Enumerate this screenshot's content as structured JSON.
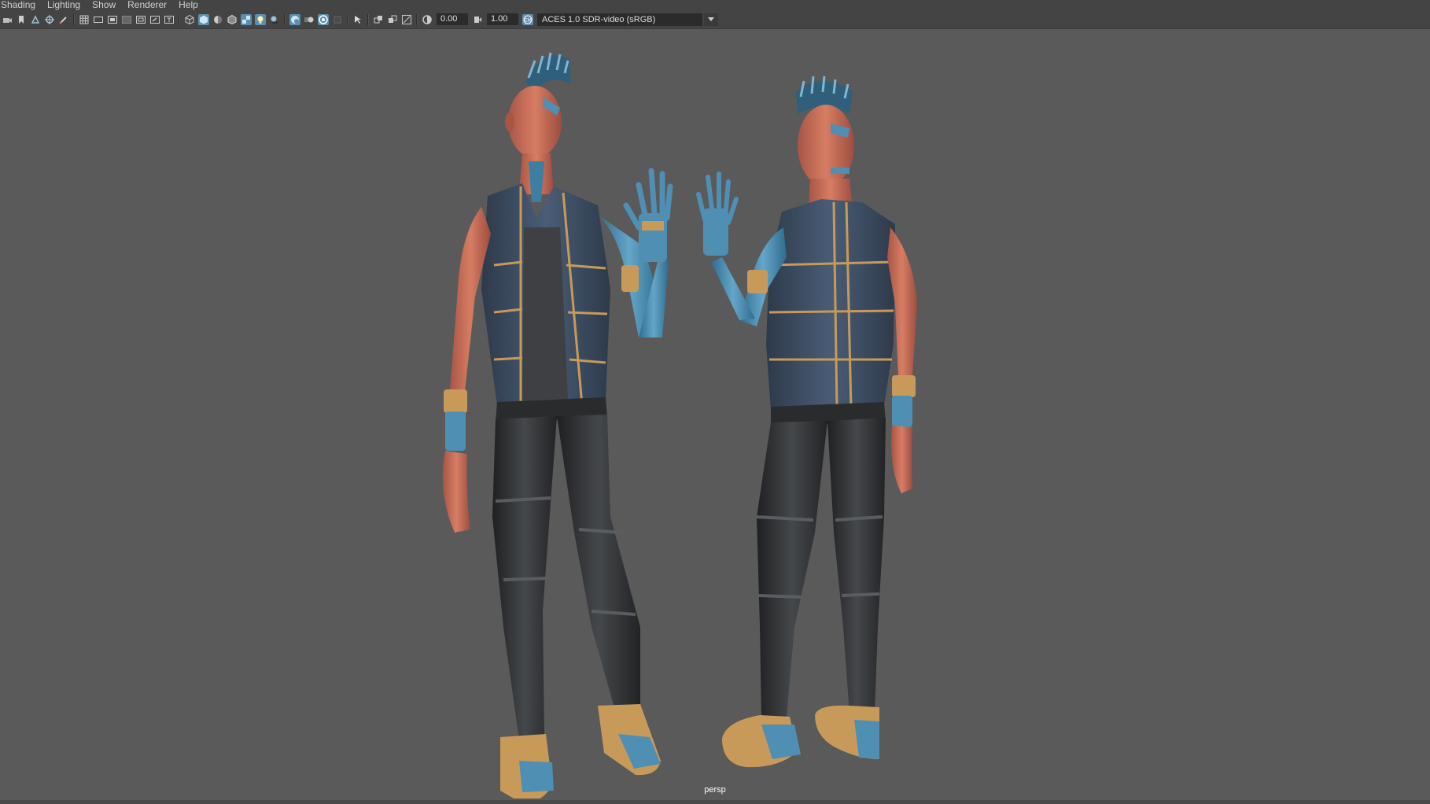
{
  "menu": [
    "Shading",
    "Lighting",
    "Show",
    "Renderer",
    "Help"
  ],
  "toolbar": {
    "exposure_value": "0.00",
    "gamma_value": "1.00",
    "color_management": "ACES 1.0 SDR-video (sRGB)",
    "icons": [
      "select-camera-icon",
      "camera-bookmark-icon",
      "image-plane-icon",
      "2d-pan-zoom-icon",
      "grease-pencil-icon",
      "grid-icon",
      "film-gate-icon",
      "resolution-gate-icon",
      "gate-mask-icon",
      "field-chart-icon",
      "safe-action-icon",
      "safe-title-icon",
      "wireframe-icon",
      "smooth-shade-icon",
      "default-material-icon",
      "wireframe-on-shaded-icon",
      "textured-icon",
      "use-all-lights-icon",
      "shadows-icon",
      "screen-space-ao-icon",
      "motion-blur-icon",
      "anti-aliasing-icon",
      "depth-of-field-icon",
      "isolate-select-icon",
      "xray-icon",
      "xray-joints-icon",
      "xray-components-icon",
      "exposure-icon",
      "gamma-icon",
      "color-management-icon"
    ],
    "active_icons": [
      "smooth-shade-icon",
      "textured-icon",
      "use-all-lights-icon",
      "screen-space-ao-icon",
      "anti-aliasing-icon",
      "depth-of-field-icon",
      "color-management-icon"
    ]
  },
  "viewport": {
    "camera_name": "persp",
    "background_color": "#5a5a5a"
  },
  "colors": {
    "ui_bg": "#444444",
    "field_bg": "#2b2b2b",
    "accent": "#5b8fb0",
    "skin": "#c8705a",
    "vest": "#3c4d63",
    "trim": "#c89a5a",
    "pants": "#2f3133",
    "cyber_blue": "#4f8fb3"
  }
}
